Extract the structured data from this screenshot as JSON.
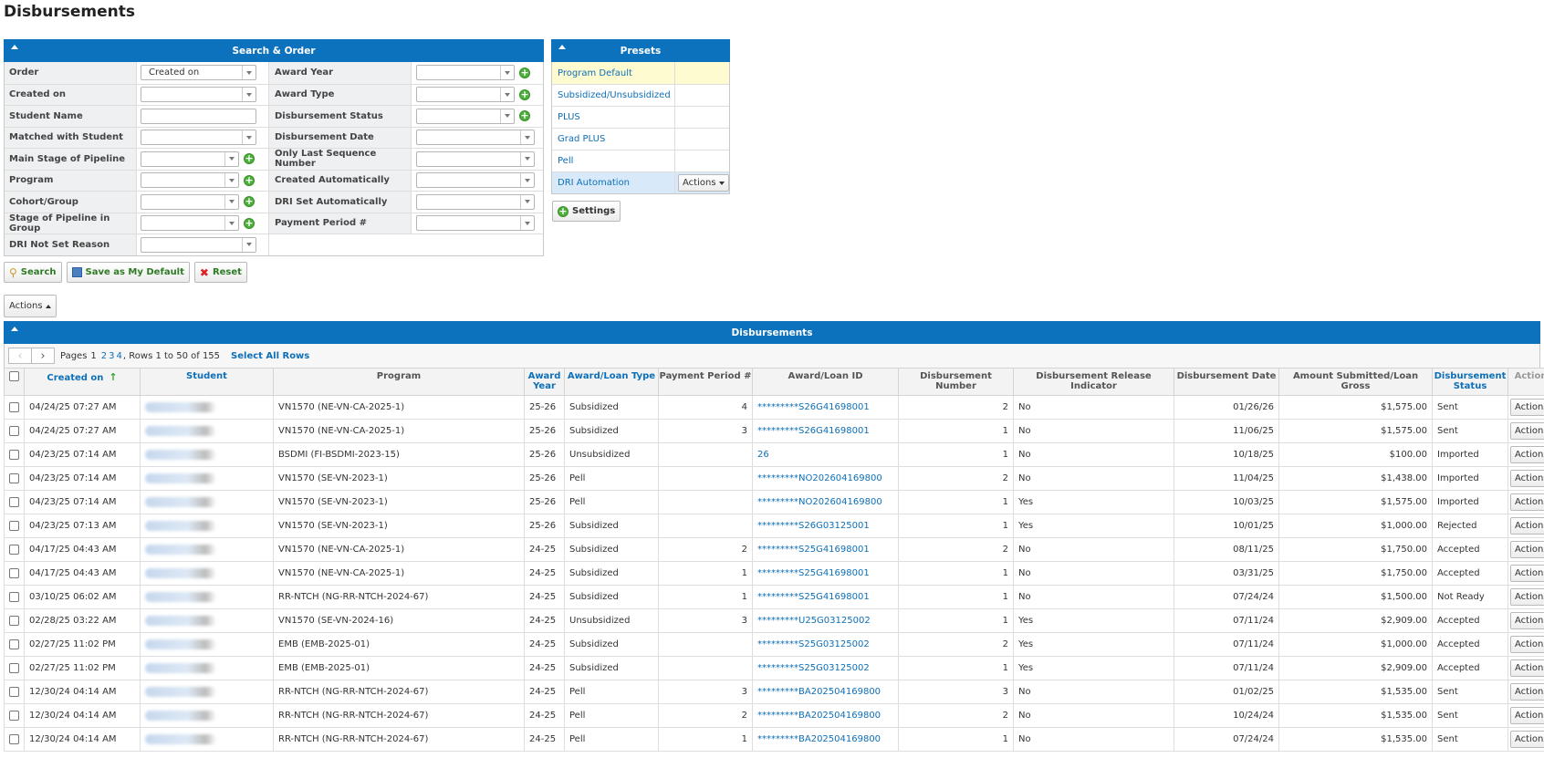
{
  "page": {
    "title": "Disbursements"
  },
  "search": {
    "header": "Search & Order",
    "rows": [
      {
        "left_label": "Order",
        "left_value": "Created on",
        "left_type": "dd",
        "left_plus": false,
        "right_label": "Award Year",
        "right_value": "",
        "right_type": "dd-short",
        "right_plus": true
      },
      {
        "left_label": "Created on",
        "left_value": "",
        "left_type": "dd",
        "left_plus": false,
        "right_label": "Award Type",
        "right_value": "",
        "right_type": "dd-short",
        "right_plus": true
      },
      {
        "left_label": "Student Name",
        "left_value": "",
        "left_type": "txt",
        "left_plus": false,
        "right_label": "Disbursement Status",
        "right_value": "",
        "right_type": "dd-short",
        "right_plus": true
      },
      {
        "left_label": "Matched with Student",
        "left_value": "",
        "left_type": "dd",
        "left_plus": false,
        "right_label": "Disbursement Date",
        "right_value": "",
        "right_type": "dd",
        "right_plus": false
      },
      {
        "left_label": "Main Stage of Pipeline",
        "left_value": "",
        "left_type": "dd-short",
        "left_plus": true,
        "right_label": "Only Last Sequence Number",
        "right_value": "",
        "right_type": "dd",
        "right_plus": false
      },
      {
        "left_label": "Program",
        "left_value": "",
        "left_type": "dd-short",
        "left_plus": true,
        "right_label": "Created Automatically",
        "right_value": "",
        "right_type": "dd",
        "right_plus": false
      },
      {
        "left_label": "Cohort/Group",
        "left_value": "",
        "left_type": "dd-short",
        "left_plus": true,
        "right_label": "DRI Set Automatically",
        "right_value": "",
        "right_type": "dd",
        "right_plus": false
      },
      {
        "left_label": "Stage of Pipeline in Group",
        "left_value": "",
        "left_type": "dd-short",
        "left_plus": true,
        "right_label": "Payment Period #",
        "right_value": "",
        "right_type": "dd",
        "right_plus": false
      },
      {
        "left_label": "DRI Not Set Reason",
        "left_value": "",
        "left_type": "dd",
        "left_plus": false,
        "right_label": "",
        "right_value": "",
        "right_type": "none",
        "right_plus": false
      }
    ],
    "buttons": {
      "search": "Search",
      "save_default": "Save as My Default",
      "reset": "Reset"
    }
  },
  "presets": {
    "header": "Presets",
    "items": [
      {
        "label": "Program Default",
        "state": "default",
        "action": ""
      },
      {
        "label": "Subsidized/Unsubsidized",
        "state": "",
        "action": ""
      },
      {
        "label": "PLUS",
        "state": "",
        "action": ""
      },
      {
        "label": "Grad PLUS",
        "state": "",
        "action": ""
      },
      {
        "label": "Pell",
        "state": "",
        "action": ""
      },
      {
        "label": "DRI Automation",
        "state": "sel",
        "action": "Actions"
      }
    ],
    "settings_label": "Settings"
  },
  "actions_label": "Actions",
  "grid": {
    "header": "Disbursements",
    "pager": {
      "pages_label": "Pages",
      "current_page": "1",
      "other_pages": [
        "2",
        "3",
        "4"
      ],
      "rows_text": ", Rows 1 to 50 of 155",
      "select_all": "Select All Rows"
    },
    "columns": [
      {
        "label": "",
        "link": false
      },
      {
        "label": "Created on",
        "link": true
      },
      {
        "label": "Student",
        "link": true
      },
      {
        "label": "Program",
        "link": false
      },
      {
        "label": "Award Year",
        "link": true
      },
      {
        "label": "Award/Loan Type",
        "link": true
      },
      {
        "label": "Payment Period #",
        "link": false
      },
      {
        "label": "Award/Loan ID",
        "link": false
      },
      {
        "label": "Disbursement Number",
        "link": false
      },
      {
        "label": "Disbursement Release Indicator",
        "link": false
      },
      {
        "label": "Disbursement Date",
        "link": false
      },
      {
        "label": "Amount Submitted/Loan Gross",
        "link": false
      },
      {
        "label": "Disbursement Status",
        "link": true
      },
      {
        "label": "Actions",
        "link": false
      }
    ],
    "row_action_label": "Actions",
    "rows": [
      {
        "created": "04/24/25 07:27 AM",
        "program": "VN1570 (NE-VN-CA-2025-1)",
        "year": "25-26",
        "type": "Subsidized",
        "period": "4",
        "loan_id": "*********S26G41698001",
        "number": "2",
        "dri": "No",
        "date": "01/26/26",
        "amount": "$1,575.00",
        "status": "Sent"
      },
      {
        "created": "04/24/25 07:27 AM",
        "program": "VN1570 (NE-VN-CA-2025-1)",
        "year": "25-26",
        "type": "Subsidized",
        "period": "3",
        "loan_id": "*********S26G41698001",
        "number": "1",
        "dri": "No",
        "date": "11/06/25",
        "amount": "$1,575.00",
        "status": "Sent"
      },
      {
        "created": "04/23/25 07:14 AM",
        "program": "BSDMI (FI-BSDMI-2023-15)",
        "year": "25-26",
        "type": "Unsubsidized",
        "period": "",
        "loan_id": "26",
        "number": "1",
        "dri": "No",
        "date": "10/18/25",
        "amount": "$100.00",
        "status": "Imported"
      },
      {
        "created": "04/23/25 07:14 AM",
        "program": "VN1570 (SE-VN-2023-1)",
        "year": "25-26",
        "type": "Pell",
        "period": "",
        "loan_id": "*********NO202604169800",
        "number": "2",
        "dri": "No",
        "date": "11/04/25",
        "amount": "$1,438.00",
        "status": "Imported"
      },
      {
        "created": "04/23/25 07:14 AM",
        "program": "VN1570 (SE-VN-2023-1)",
        "year": "25-26",
        "type": "Pell",
        "period": "",
        "loan_id": "*********NO202604169800",
        "number": "1",
        "dri": "Yes",
        "date": "10/03/25",
        "amount": "$1,575.00",
        "status": "Imported"
      },
      {
        "created": "04/23/25 07:13 AM",
        "program": "VN1570 (SE-VN-2023-1)",
        "year": "25-26",
        "type": "Subsidized",
        "period": "",
        "loan_id": "*********S26G03125001",
        "number": "1",
        "dri": "Yes",
        "date": "10/01/25",
        "amount": "$1,000.00",
        "status": "Rejected"
      },
      {
        "created": "04/17/25 04:43 AM",
        "program": "VN1570 (NE-VN-CA-2025-1)",
        "year": "24-25",
        "type": "Subsidized",
        "period": "2",
        "loan_id": "*********S25G41698001",
        "number": "2",
        "dri": "No",
        "date": "08/11/25",
        "amount": "$1,750.00",
        "status": "Accepted"
      },
      {
        "created": "04/17/25 04:43 AM",
        "program": "VN1570 (NE-VN-CA-2025-1)",
        "year": "24-25",
        "type": "Subsidized",
        "period": "1",
        "loan_id": "*********S25G41698001",
        "number": "1",
        "dri": "No",
        "date": "03/31/25",
        "amount": "$1,750.00",
        "status": "Accepted"
      },
      {
        "created": "03/10/25 06:02 AM",
        "program": "RR-NTCH (NG-RR-NTCH-2024-67)",
        "year": "24-25",
        "type": "Subsidized",
        "period": "1",
        "loan_id": "*********S25G41698001",
        "number": "1",
        "dri": "No",
        "date": "07/24/24",
        "amount": "$1,500.00",
        "status": "Not Ready"
      },
      {
        "created": "02/28/25 03:22 AM",
        "program": "VN1570 (SE-VN-2024-16)",
        "year": "24-25",
        "type": "Unsubsidized",
        "period": "3",
        "loan_id": "*********U25G03125002",
        "number": "1",
        "dri": "Yes",
        "date": "07/11/24",
        "amount": "$2,909.00",
        "status": "Accepted"
      },
      {
        "created": "02/27/25 11:02 PM",
        "program": "EMB (EMB-2025-01)",
        "year": "24-25",
        "type": "Subsidized",
        "period": "",
        "loan_id": "*********S25G03125002",
        "number": "2",
        "dri": "Yes",
        "date": "07/11/24",
        "amount": "$1,000.00",
        "status": "Accepted"
      },
      {
        "created": "02/27/25 11:02 PM",
        "program": "EMB (EMB-2025-01)",
        "year": "24-25",
        "type": "Subsidized",
        "period": "",
        "loan_id": "*********S25G03125002",
        "number": "1",
        "dri": "Yes",
        "date": "07/11/24",
        "amount": "$2,909.00",
        "status": "Accepted"
      },
      {
        "created": "12/30/24 04:14 AM",
        "program": "RR-NTCH (NG-RR-NTCH-2024-67)",
        "year": "24-25",
        "type": "Pell",
        "period": "3",
        "loan_id": "*********BA202504169800",
        "number": "3",
        "dri": "No",
        "date": "01/02/25",
        "amount": "$1,535.00",
        "status": "Sent"
      },
      {
        "created": "12/30/24 04:14 AM",
        "program": "RR-NTCH (NG-RR-NTCH-2024-67)",
        "year": "24-25",
        "type": "Pell",
        "period": "2",
        "loan_id": "*********BA202504169800",
        "number": "2",
        "dri": "No",
        "date": "10/24/24",
        "amount": "$1,535.00",
        "status": "Sent"
      },
      {
        "created": "12/30/24 04:14 AM",
        "program": "RR-NTCH (NG-RR-NTCH-2024-67)",
        "year": "24-25",
        "type": "Pell",
        "period": "1",
        "loan_id": "*********BA202504169800",
        "number": "1",
        "dri": "No",
        "date": "07/24/24",
        "amount": "$1,535.00",
        "status": "Sent"
      }
    ]
  }
}
